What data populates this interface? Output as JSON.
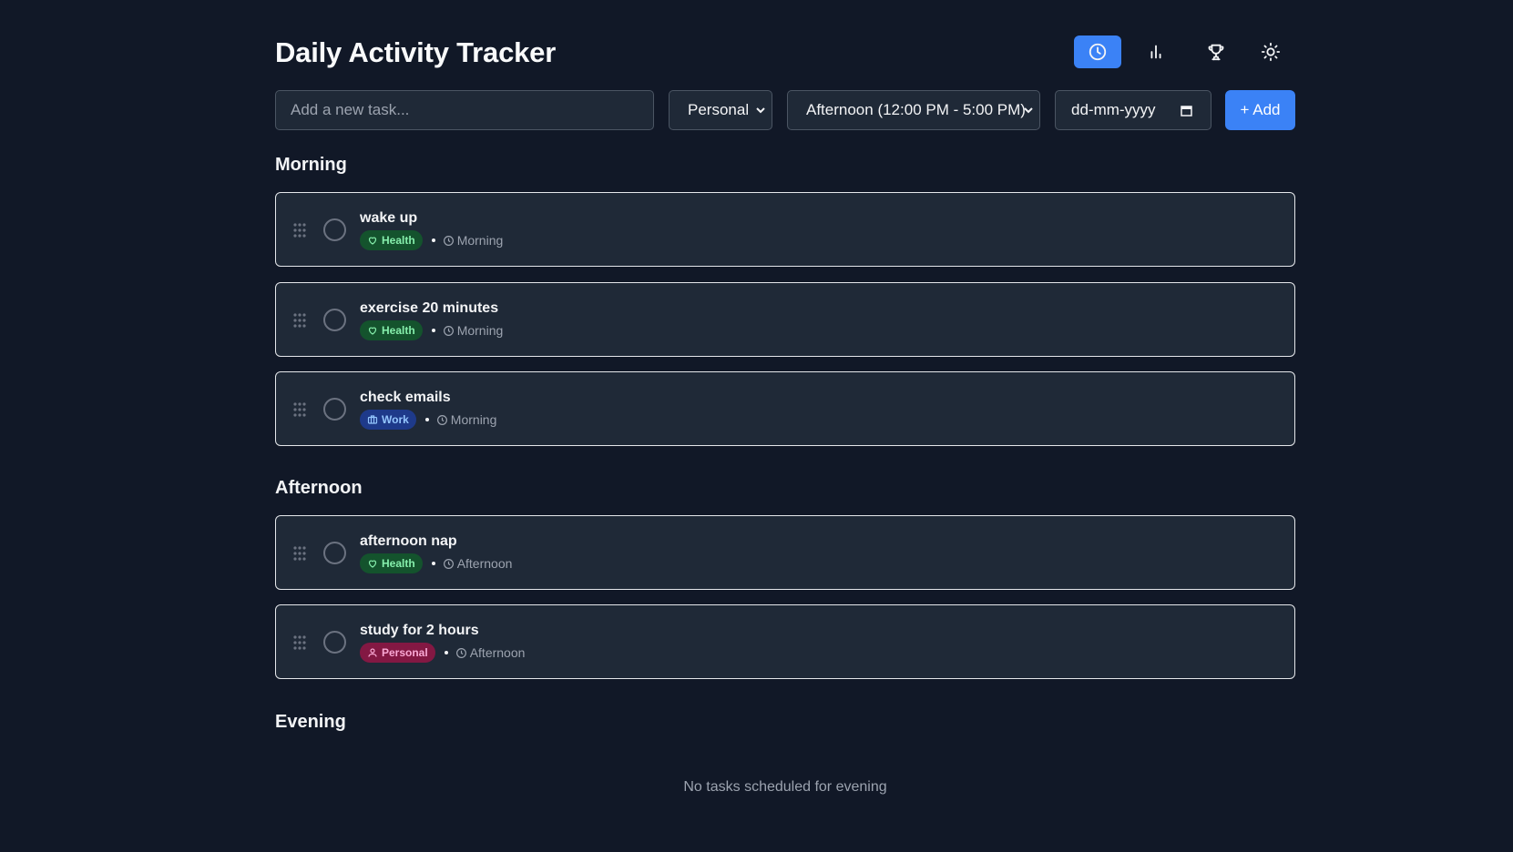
{
  "app": {
    "title": "Daily Activity Tracker"
  },
  "header_buttons": [
    {
      "name": "clock-view-button",
      "icon": "clock-icon",
      "active": true
    },
    {
      "name": "stats-view-button",
      "icon": "bar-chart-icon",
      "active": false
    },
    {
      "name": "achievements-view-button",
      "icon": "trophy-icon",
      "active": false
    },
    {
      "name": "theme-toggle-button",
      "icon": "sun-icon",
      "active": false
    }
  ],
  "controls": {
    "task_placeholder": "Add a new task...",
    "category_value": "Personal",
    "time_value": "Afternoon (12:00 PM - 5:00 PM)",
    "date_placeholder": "dd-mm-yyyy",
    "add_label": "+ Add"
  },
  "sections": {
    "morning": {
      "title": "Morning",
      "tasks": [
        {
          "title": "wake up",
          "category": "Health",
          "time": "Morning"
        },
        {
          "title": "exercise 20 minutes",
          "category": "Health",
          "time": "Morning"
        },
        {
          "title": "check emails",
          "category": "Work",
          "time": "Morning"
        }
      ]
    },
    "afternoon": {
      "title": "Afternoon",
      "tasks": [
        {
          "title": "afternoon nap",
          "category": "Health",
          "time": "Afternoon"
        },
        {
          "title": "study for 2 hours",
          "category": "Personal",
          "time": "Afternoon"
        }
      ]
    },
    "evening": {
      "title": "Evening",
      "empty_text": "No tasks scheduled for evening"
    }
  },
  "colors": {
    "background": "#111827",
    "card": "#1f2937",
    "accent": "#3b82f6",
    "health": "#86efac",
    "work": "#93c5fd",
    "personal": "#f9a8d4"
  }
}
